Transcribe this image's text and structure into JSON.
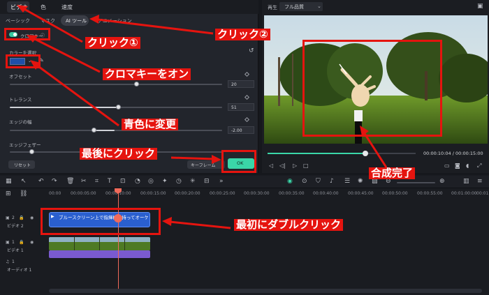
{
  "panel": {
    "tabs": [
      "ビデオ",
      "色",
      "速度"
    ],
    "subtabs": [
      "ベーシック",
      "マスク",
      "AI ツール",
      "アニメーション"
    ],
    "chroma_label": "クロマキー",
    "color_label": "カラーを選択",
    "offset_label": "オフセット",
    "offset_value": "20",
    "tolerance_label": "トレランス",
    "tolerance_value": "51",
    "edge_label": "エッジの幅",
    "edge_value": "-2.00",
    "feather_label": "エッジフェザー",
    "reset_label": "リセット",
    "keyframe_label": "キーフレーム",
    "ok_label": "OK",
    "key_color": "#1e4fa8"
  },
  "preview": {
    "header_label": "再生",
    "quality": "フル品質",
    "time_current": "00:00:10:04",
    "time_total": "00:00:15:00",
    "progress": 0.66
  },
  "timeline": {
    "ticks": [
      "00:00",
      "00:00:05:00",
      "00:00:10:00",
      "00:00:15:00",
      "00:00:20:00",
      "00:00:25:00",
      "00:00:30:00",
      "00:00:35:00",
      "00:00:40:00",
      "00:00:45:00",
      "00:00:50:00",
      "00:00:55:00",
      "00:01:00:00",
      "00:01:05:00"
    ],
    "track2_label": "ビデオ 2",
    "track1_label": "ビデオ 1",
    "audio_label": "オーディオ 1",
    "blue_clip_title": "ブルースクリーン上で指揮棒を持ってオーケストラを",
    "track2_num": "2",
    "track1_num": "1",
    "audio_num": "1"
  },
  "annotations": {
    "click1": "クリック①",
    "click2": "クリック②",
    "chroma_on": "クロマキーをオン",
    "blue_change": "青色に変更",
    "last_click": "最後にクリック",
    "composite_done": "合成完了",
    "first_double": "最初にダブルクリック"
  }
}
